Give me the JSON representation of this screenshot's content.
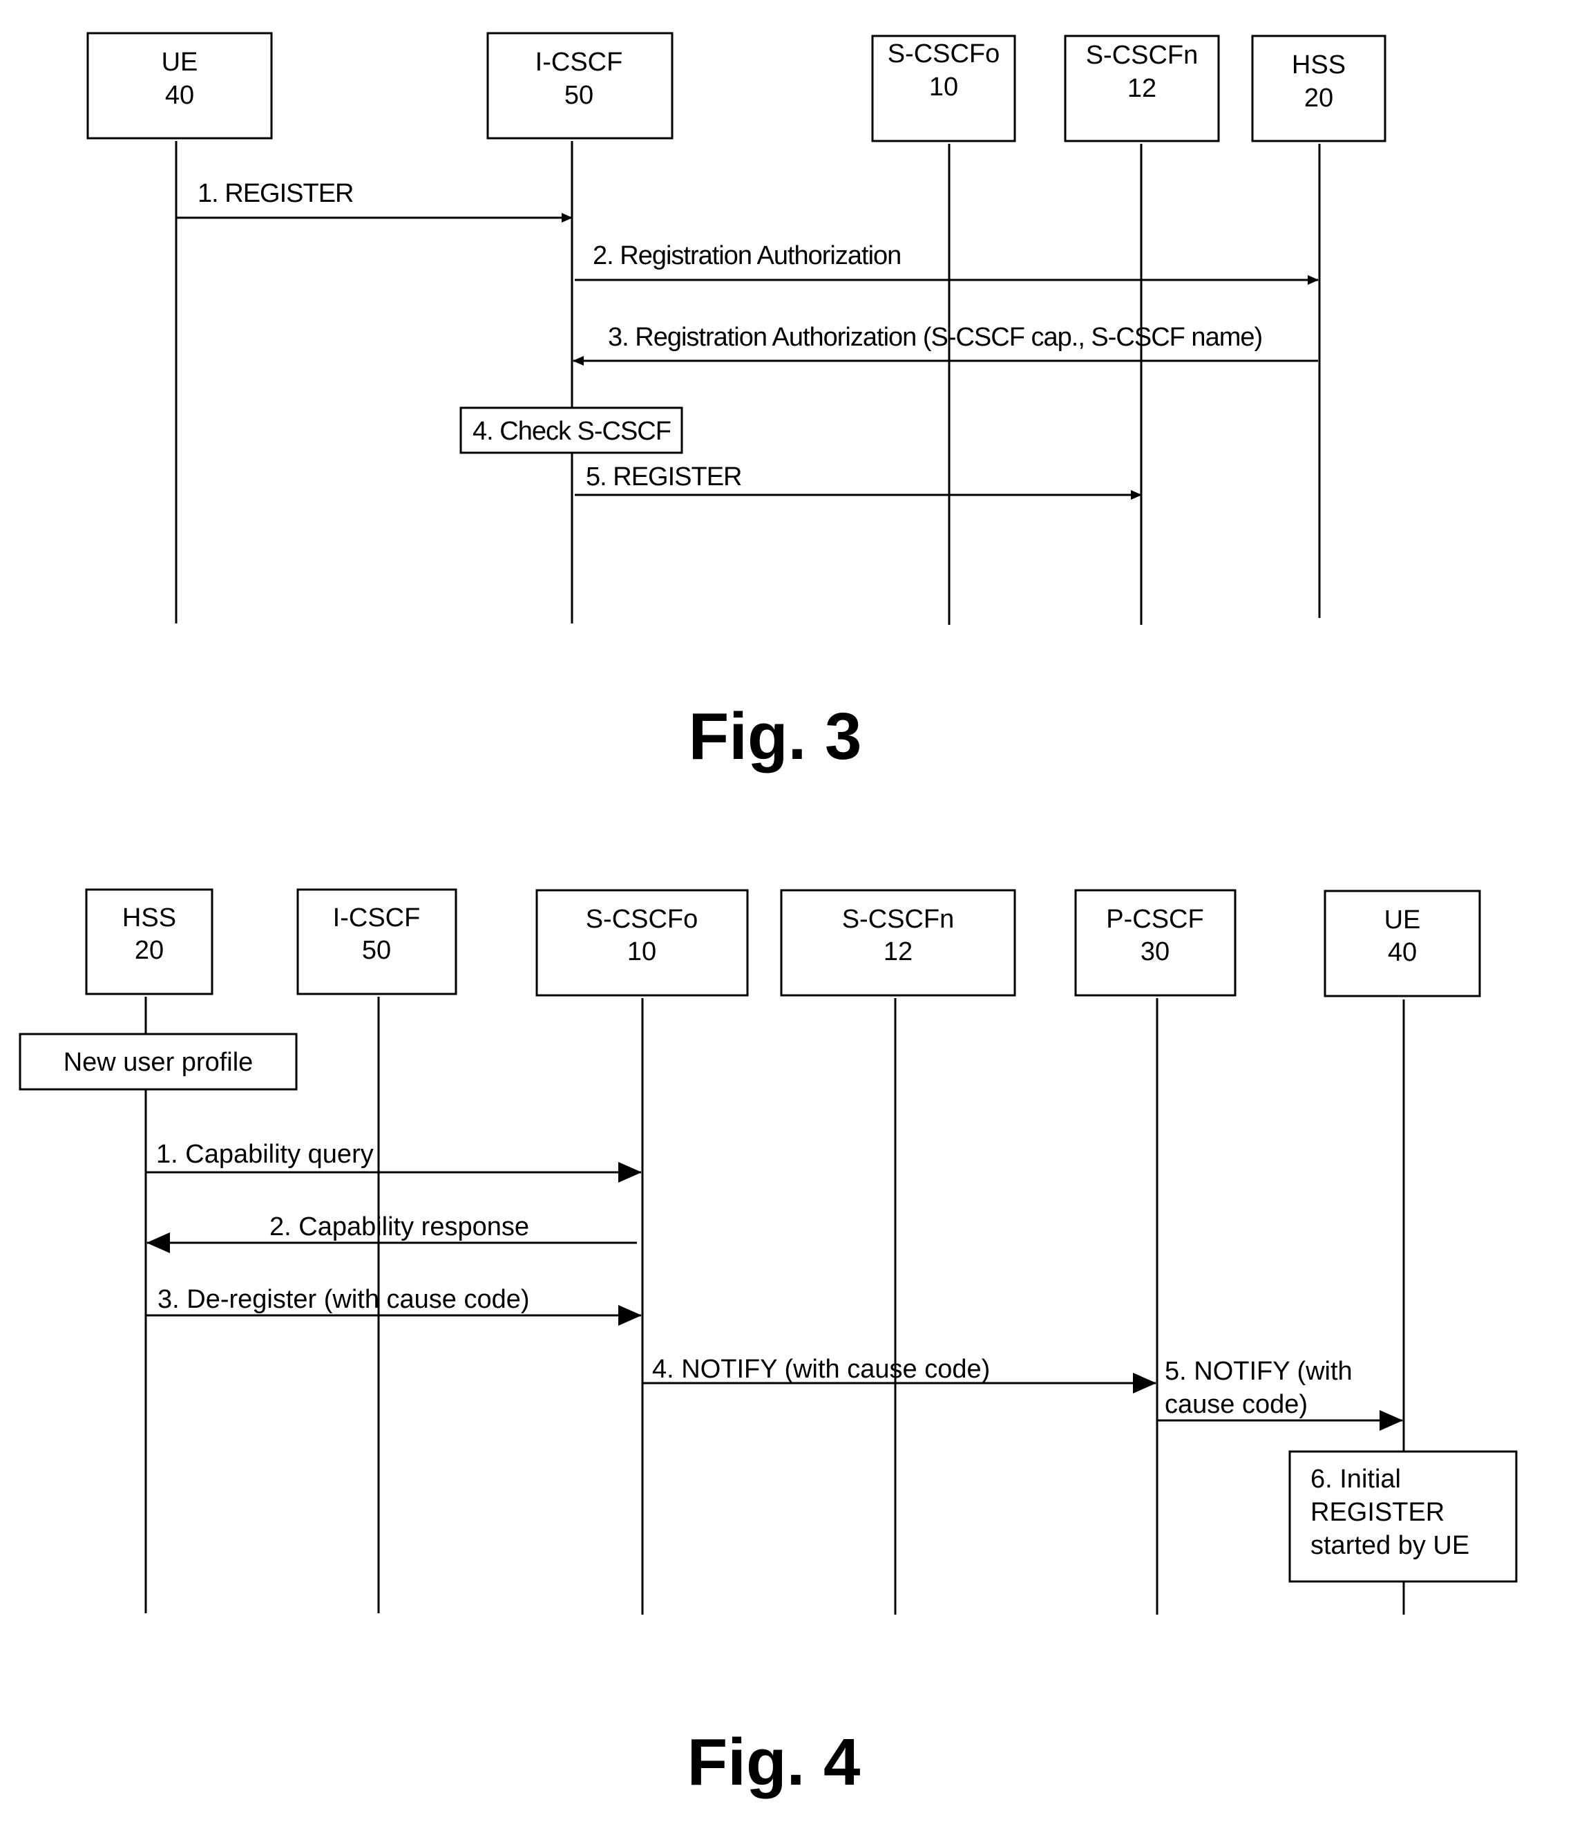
{
  "fig3": {
    "caption": "Fig. 3",
    "entities": [
      {
        "name": "UE",
        "ref": "40"
      },
      {
        "name": "I-CSCF",
        "ref": "50"
      },
      {
        "name": "S-CSCFo",
        "ref": "10"
      },
      {
        "name": "S-CSCFn",
        "ref": "12"
      },
      {
        "name": "HSS",
        "ref": "20"
      }
    ],
    "messages": [
      {
        "label": "1. REGISTER",
        "from": "UE",
        "to": "I-CSCF"
      },
      {
        "label": "2. Registration Authorization",
        "from": "I-CSCF",
        "to": "HSS"
      },
      {
        "label": "3. Registration Authorization (S-CSCF cap., S-CSCF name)",
        "from": "HSS",
        "to": "I-CSCF"
      },
      {
        "label": "5. REGISTER",
        "from": "I-CSCF",
        "to": "S-CSCFn"
      }
    ],
    "notes": [
      {
        "label": "4. Check S-CSCF",
        "at": "I-CSCF"
      }
    ]
  },
  "fig4": {
    "caption": "Fig. 4",
    "entities": [
      {
        "name": "HSS",
        "ref": "20"
      },
      {
        "name": "I-CSCF",
        "ref": "50"
      },
      {
        "name": "S-CSCFo",
        "ref": "10"
      },
      {
        "name": "S-CSCFn",
        "ref": "12"
      },
      {
        "name": "P-CSCF",
        "ref": "30"
      },
      {
        "name": "UE",
        "ref": "40"
      }
    ],
    "messages": [
      {
        "label": "1. Capability query",
        "from": "HSS",
        "to": "S-CSCFo"
      },
      {
        "label": "2. Capability response",
        "from": "S-CSCFo",
        "to": "HSS"
      },
      {
        "label": "3. De-register (with cause code)",
        "from": "HSS",
        "to": "S-CSCFo"
      },
      {
        "label": "4. NOTIFY (with cause code)",
        "from": "S-CSCFo",
        "to": "P-CSCF"
      },
      {
        "label_lines": [
          "5. NOTIFY (with",
          "cause code)"
        ],
        "from": "P-CSCF",
        "to": "UE"
      }
    ],
    "notes": [
      {
        "label": "New user profile",
        "at": "HSS"
      },
      {
        "label_lines": [
          "6. Initial",
          "REGISTER",
          "started by UE"
        ],
        "at": "UE"
      }
    ]
  }
}
